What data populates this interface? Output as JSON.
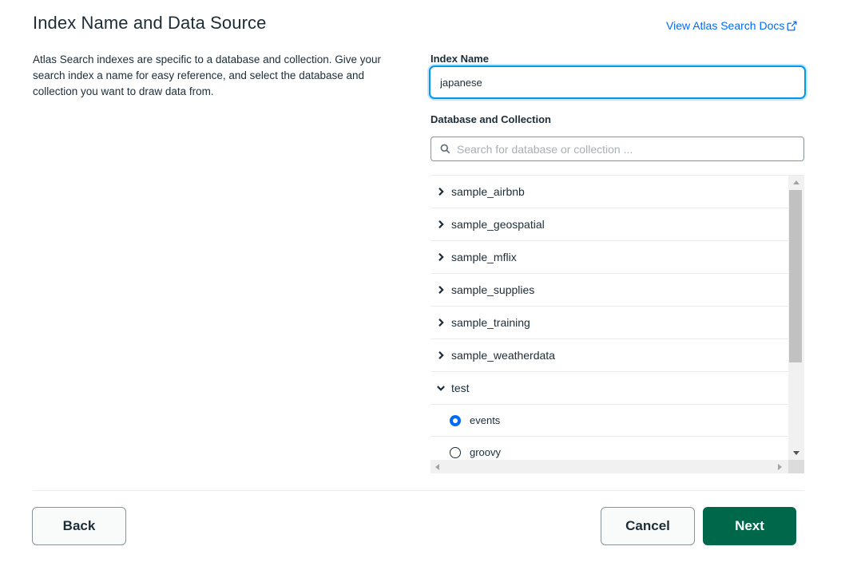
{
  "header": {
    "title": "Index Name and Data Source",
    "docs_link": "View Atlas Search Docs",
    "docs_icon": "external-link-icon"
  },
  "description": "Atlas Search indexes are specific to a database and collection. Give your search index a name for easy reference, and select the database and collection you want to draw data from.",
  "index_name": {
    "label": "Index Name",
    "value": "japanese"
  },
  "database_collection": {
    "label": "Database and Collection",
    "search_placeholder": "Search for database or collection ...",
    "search_icon": "search-icon",
    "databases": [
      {
        "label": "sample_airbnb",
        "expanded": false
      },
      {
        "label": "sample_geospatial",
        "expanded": false
      },
      {
        "label": "sample_mflix",
        "expanded": false
      },
      {
        "label": "sample_supplies",
        "expanded": false
      },
      {
        "label": "sample_training",
        "expanded": false
      },
      {
        "label": "sample_weatherdata",
        "expanded": false
      },
      {
        "label": "test",
        "expanded": true
      }
    ],
    "collections": [
      {
        "label": "events",
        "selected": true
      },
      {
        "label": "groovy",
        "selected": false
      }
    ]
  },
  "footer": {
    "back_label": "Back",
    "cancel_label": "Cancel",
    "next_label": "Next"
  },
  "colors": {
    "primary_green": "#00684a",
    "link_blue": "#016bf8",
    "focus_blue": "#0498ec"
  }
}
